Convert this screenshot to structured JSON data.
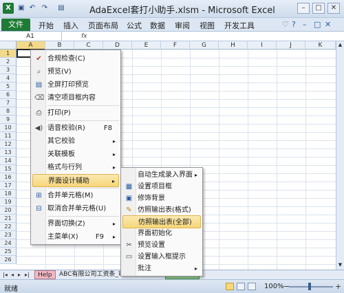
{
  "window": {
    "title": "AdaExcel套打小助手.xlsm - Microsoft Excel"
  },
  "ribbon": {
    "file_tab": "文件",
    "tabs": [
      "开始",
      "插入",
      "页面布局",
      "公式",
      "数据",
      "审阅",
      "视图",
      "开发工具"
    ]
  },
  "formula_bar": {
    "name_box": "A1",
    "fx": "fx"
  },
  "sheet": {
    "columns": [
      "A",
      "B",
      "C",
      "D",
      "E",
      "F",
      "G",
      "H",
      "I",
      "J",
      "K"
    ],
    "rows": [
      "1",
      "2",
      "3",
      "4",
      "5",
      "6",
      "7",
      "8",
      "9",
      "10",
      "11",
      "12",
      "13",
      "14",
      "15",
      "16",
      "17",
      "18",
      "19",
      "20",
      "21",
      "22",
      "23",
      "24",
      "25",
      "26"
    ]
  },
  "sheet_tabs": {
    "help": "Help",
    "main": "ABC有限公司工资条_审计",
    "third": "..."
  },
  "status": {
    "ready": "就绪",
    "zoom": "100%",
    "zoom_minus": "−",
    "zoom_plus": "+"
  },
  "context_menu": {
    "items": [
      {
        "label": "合规检查(C)",
        "icon": "check-icon"
      },
      {
        "label": "预览(V)",
        "icon": "magnifier-icon"
      },
      {
        "label": "全屏打印预览",
        "icon": "document-icon"
      },
      {
        "label": "清空项目框内容",
        "icon": "eraser-icon"
      },
      {
        "label": "打印(P)",
        "icon": "printer-icon"
      },
      {
        "label": "语音校验(R)",
        "shortcut": "F8",
        "icon": "speaker-icon"
      },
      {
        "label": "其它校验",
        "arrow": "▸"
      },
      {
        "label": "关联模板",
        "arrow": "▸"
      },
      {
        "label": "格式与行列",
        "arrow": "▸"
      },
      {
        "label": "界面设计辅助",
        "arrow": "▸"
      },
      {
        "label": "合并单元格(M)",
        "icon": "merge-icon"
      },
      {
        "label": "取消合并单元格(U)",
        "icon": "unmerge-icon"
      },
      {
        "label": "界面切换(Z)",
        "arrow": "▸"
      },
      {
        "label": "主菜单(X)",
        "shortcut": "F9",
        "arrow": "▸"
      }
    ]
  },
  "submenu": {
    "items": [
      {
        "label": "自动生成录入界面",
        "arrow": "▸"
      },
      {
        "label": "设置项目框",
        "icon": "field-icon"
      },
      {
        "label": "修饰背景",
        "icon": "background-icon"
      },
      {
        "label": "仿照输出表(格式)",
        "icon": "brush-icon"
      },
      {
        "label": "仿照输出表(全部)"
      },
      {
        "label": "界面初始化"
      },
      {
        "label": "预览设置",
        "icon": "scissors-icon"
      },
      {
        "label": "设置输入框提示",
        "icon": "comment-icon"
      },
      {
        "label": "批注",
        "arrow": "▸"
      }
    ]
  },
  "colors": {
    "excel_green": "#1f7a35",
    "highlight": "#f6d67a"
  }
}
